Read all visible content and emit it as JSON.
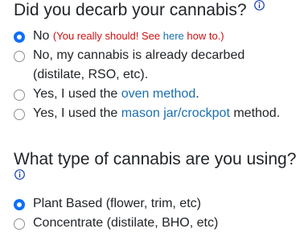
{
  "colors": {
    "accent": "#0d6efd",
    "link": "#1a6fb0",
    "warning": "#d01010",
    "text": "#212529"
  },
  "q1": {
    "title": "Did you decarb your cannabis?",
    "info_icon": "info-icon",
    "options": [
      {
        "label": "No",
        "selected": true,
        "note_prefix": "(You really should! See ",
        "note_link": "here",
        "note_suffix": " how to.)"
      },
      {
        "label": "No, my cannabis is already decarbed",
        "label_cont": "(distilate, RSO, etc).",
        "selected": false
      },
      {
        "prefix": "Yes, I used the ",
        "link": "oven method",
        "suffix": ".",
        "selected": false
      },
      {
        "prefix": "Yes, I used the ",
        "link": "mason jar/crockpot",
        "suffix": " method.",
        "selected": false
      }
    ]
  },
  "q2": {
    "title": "What type of cannabis are you using?",
    "info_icon": "info-icon",
    "options": [
      {
        "label": "Plant Based (flower, trim, etc)",
        "selected": true
      },
      {
        "label": "Concentrate (distilate, BHO, etc)",
        "selected": false
      }
    ]
  }
}
